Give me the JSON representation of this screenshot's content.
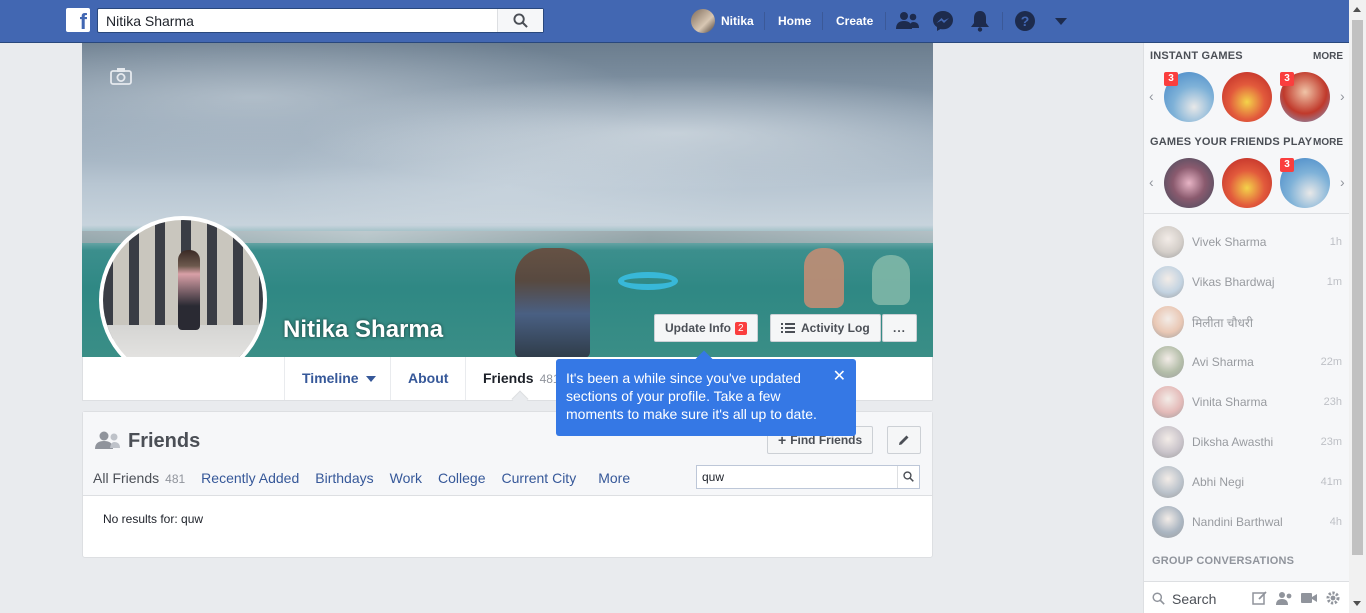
{
  "topbar": {
    "search_value": "Nitika Sharma",
    "user_name": "Nitika",
    "home_label": "Home",
    "create_label": "Create"
  },
  "cover": {
    "profile_name": "Nitika Sharma",
    "update_info_label": "Update Info",
    "update_info_badge": "2",
    "activity_log_label": "Activity Log",
    "more_label": "..."
  },
  "timeline_tabs": {
    "timeline": "Timeline",
    "about": "About",
    "friends": "Friends",
    "friends_count": "481"
  },
  "tooltip": {
    "text": "It's been a while since you've updated sections of your profile. Take a few moments to make sure it's all up to date."
  },
  "friends_section": {
    "title": "Friends",
    "find_friends_label": "Find Friends",
    "tabs": [
      {
        "label": "All Friends",
        "count": "481"
      },
      {
        "label": "Recently Added"
      },
      {
        "label": "Birthdays"
      },
      {
        "label": "Work"
      },
      {
        "label": "College"
      },
      {
        "label": "Current City"
      },
      {
        "label": "More"
      }
    ],
    "search_value": "quw",
    "no_results": "No results for: quw"
  },
  "sidebar": {
    "instant_games_title": "INSTANT GAMES",
    "instant_games_more": "MORE",
    "friends_games_title": "GAMES YOUR FRIENDS PLAY",
    "friends_games_more": "MORE",
    "instant_badges": [
      "3",
      "3"
    ],
    "friends_badges": [
      "3"
    ],
    "contacts": [
      {
        "name": "Vivek Sharma",
        "time": "1h",
        "color": "#b9aea3"
      },
      {
        "name": "Vikas Bhardwaj",
        "time": "1m",
        "color": "#9bb7cf"
      },
      {
        "name": "मिलीता चौधरी",
        "time": "",
        "color": "#e0a27e"
      },
      {
        "name": "Avi Sharma",
        "time": "22m",
        "color": "#7f9069"
      },
      {
        "name": "Vinita Sharma",
        "time": "23h",
        "color": "#d68a85"
      },
      {
        "name": "Diksha Awasthi",
        "time": "23m",
        "color": "#a79ca6"
      },
      {
        "name": "Abhi Negi",
        "time": "41m",
        "color": "#8d9aa8"
      },
      {
        "name": "Nandini Barthwal",
        "time": "4h",
        "color": "#6f8296"
      }
    ],
    "group_conversations_title": "GROUP CONVERSATIONS",
    "chat_search_placeholder": "Search"
  },
  "colors": {
    "brand_blue": "#4267b2",
    "tooltip_blue": "#3578e5",
    "badge_red": "#fa3e3e"
  }
}
